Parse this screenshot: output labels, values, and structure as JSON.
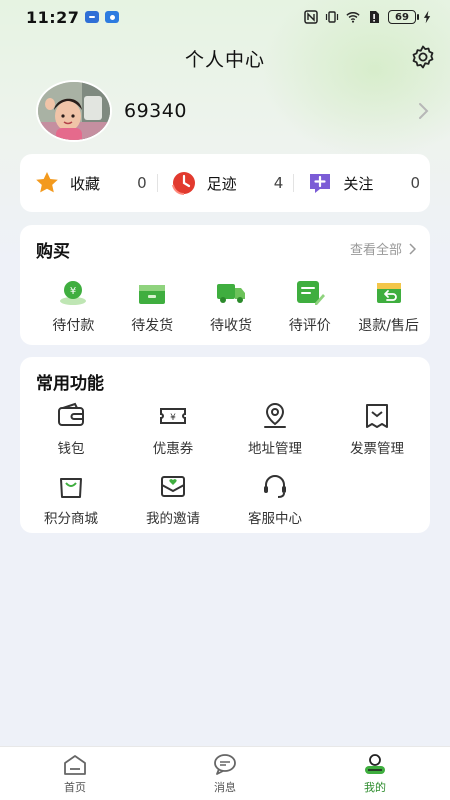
{
  "status_bar": {
    "time": "11:27",
    "battery": "69"
  },
  "header": {
    "title": "个人中心"
  },
  "profile": {
    "username": "69340"
  },
  "stats": [
    {
      "label": "收藏",
      "count": "0",
      "icon": "star-icon"
    },
    {
      "label": "足迹",
      "count": "4",
      "icon": "footprint-clock-icon"
    },
    {
      "label": "关注",
      "count": "0",
      "icon": "follow-plus-icon"
    }
  ],
  "purchase": {
    "title": "购买",
    "view_all": "查看全部",
    "orders": [
      {
        "label": "待付款",
        "icon": "wallet-yen-icon"
      },
      {
        "label": "待发货",
        "icon": "box-icon"
      },
      {
        "label": "待收货",
        "icon": "truck-icon"
      },
      {
        "label": "待评价",
        "icon": "review-icon"
      },
      {
        "label": "退款/售后",
        "icon": "refund-icon"
      }
    ]
  },
  "functions": {
    "title": "常用功能",
    "items": [
      {
        "label": "钱包",
        "icon": "wallet-icon"
      },
      {
        "label": "优惠券",
        "icon": "coupon-icon"
      },
      {
        "label": "地址管理",
        "icon": "location-icon"
      },
      {
        "label": "发票管理",
        "icon": "invoice-icon"
      },
      {
        "label": "积分商城",
        "icon": "shopping-bag-icon"
      },
      {
        "label": "我的邀请",
        "icon": "invite-envelope-icon"
      },
      {
        "label": "客服中心",
        "icon": "headset-icon"
      }
    ]
  },
  "tabbar": {
    "tabs": [
      {
        "label": "首页",
        "icon": "home-icon",
        "active": false
      },
      {
        "label": "消息",
        "icon": "message-icon",
        "active": false
      },
      {
        "label": "我的",
        "icon": "profile-icon",
        "active": true
      }
    ]
  },
  "colors": {
    "accent_green": "#3fae3f",
    "star_orange": "#f39a1e",
    "footprint_red": "#e23a2e",
    "follow_purple": "#7b5cd6"
  }
}
